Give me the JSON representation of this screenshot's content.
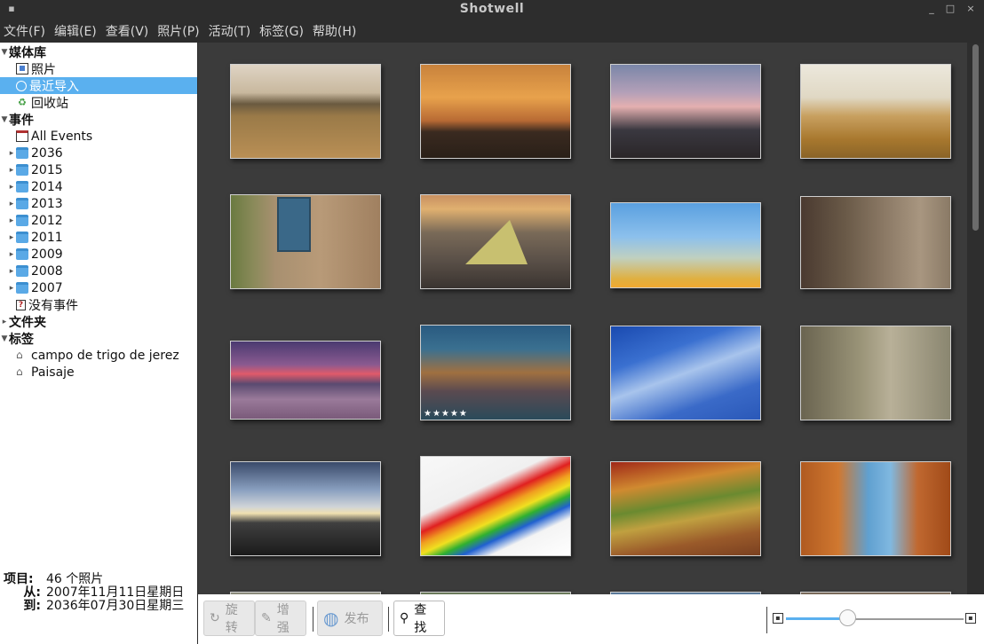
{
  "window": {
    "title": "Shotwell",
    "minimize_glyph": "_",
    "maximize_glyph": "□",
    "close_glyph": "×"
  },
  "menubar": [
    {
      "label": "文件(F)"
    },
    {
      "label": "编辑(E)"
    },
    {
      "label": "查看(V)"
    },
    {
      "label": "照片(P)"
    },
    {
      "label": "活动(T)"
    },
    {
      "label": "标签(G)"
    },
    {
      "label": "帮助(H)"
    }
  ],
  "sidebar": {
    "library": {
      "header": "媒体库",
      "items": [
        {
          "label": "照片",
          "icon": "photos-icon",
          "selected": false
        },
        {
          "label": "最近导入",
          "icon": "clock-icon",
          "selected": true
        },
        {
          "label": "回收站",
          "icon": "trash-icon",
          "selected": false
        }
      ]
    },
    "events": {
      "header": "事件",
      "all_label": "All Events",
      "years": [
        "2036",
        "2015",
        "2014",
        "2013",
        "2012",
        "2011",
        "2009",
        "2008",
        "2007"
      ],
      "no_event_label": "没有事件"
    },
    "folders_header": "文件夹",
    "tags": {
      "header": "标签",
      "items": [
        "campo de trigo de jerez",
        "Paisaje"
      ]
    },
    "info": {
      "items_label": "项目:",
      "items_value": "46 个照片",
      "from_label": "从:",
      "from_value": "2007年11月11日星期日",
      "to_label": "到:",
      "to_value": "2036年07月30日星期三"
    }
  },
  "photos": [
    {
      "name": "wheat-field-sunset",
      "rating_stars": ""
    },
    {
      "name": "orange-sunset-field",
      "rating_stars": ""
    },
    {
      "name": "pink-dusk-trees",
      "rating_stars": ""
    },
    {
      "name": "wheat-closeup",
      "rating_stars": ""
    },
    {
      "name": "wooden-wall-window",
      "rating_stars": ""
    },
    {
      "name": "paper-boat-pebbles",
      "rating_stars": ""
    },
    {
      "name": "blurred-blue-orange",
      "rating_stars": ""
    },
    {
      "name": "bicycle-street-sepia",
      "rating_stars": ""
    },
    {
      "name": "purple-lake-sunset",
      "rating_stars": ""
    },
    {
      "name": "venice-canal-night",
      "rating_stars": "★★★★★"
    },
    {
      "name": "blue-sky-blossom",
      "rating_stars": ""
    },
    {
      "name": "white-blossom-bokeh",
      "rating_stars": ""
    },
    {
      "name": "cloudy-sea-horizon",
      "rating_stars": ""
    },
    {
      "name": "rainbow-pencils-boat",
      "rating_stars": ""
    },
    {
      "name": "colorful-terraces",
      "rating_stars": ""
    },
    {
      "name": "red-rock-arch",
      "rating_stars": ""
    }
  ],
  "toolbar": {
    "rotate_label": "旋转",
    "enhance_label": "增强",
    "publish_label": "发布",
    "find_label": "查找"
  },
  "colors": {
    "selection": "#5ab0ef",
    "grid_background": "#3b3b3b",
    "titlebar": "#2d2d2d"
  }
}
